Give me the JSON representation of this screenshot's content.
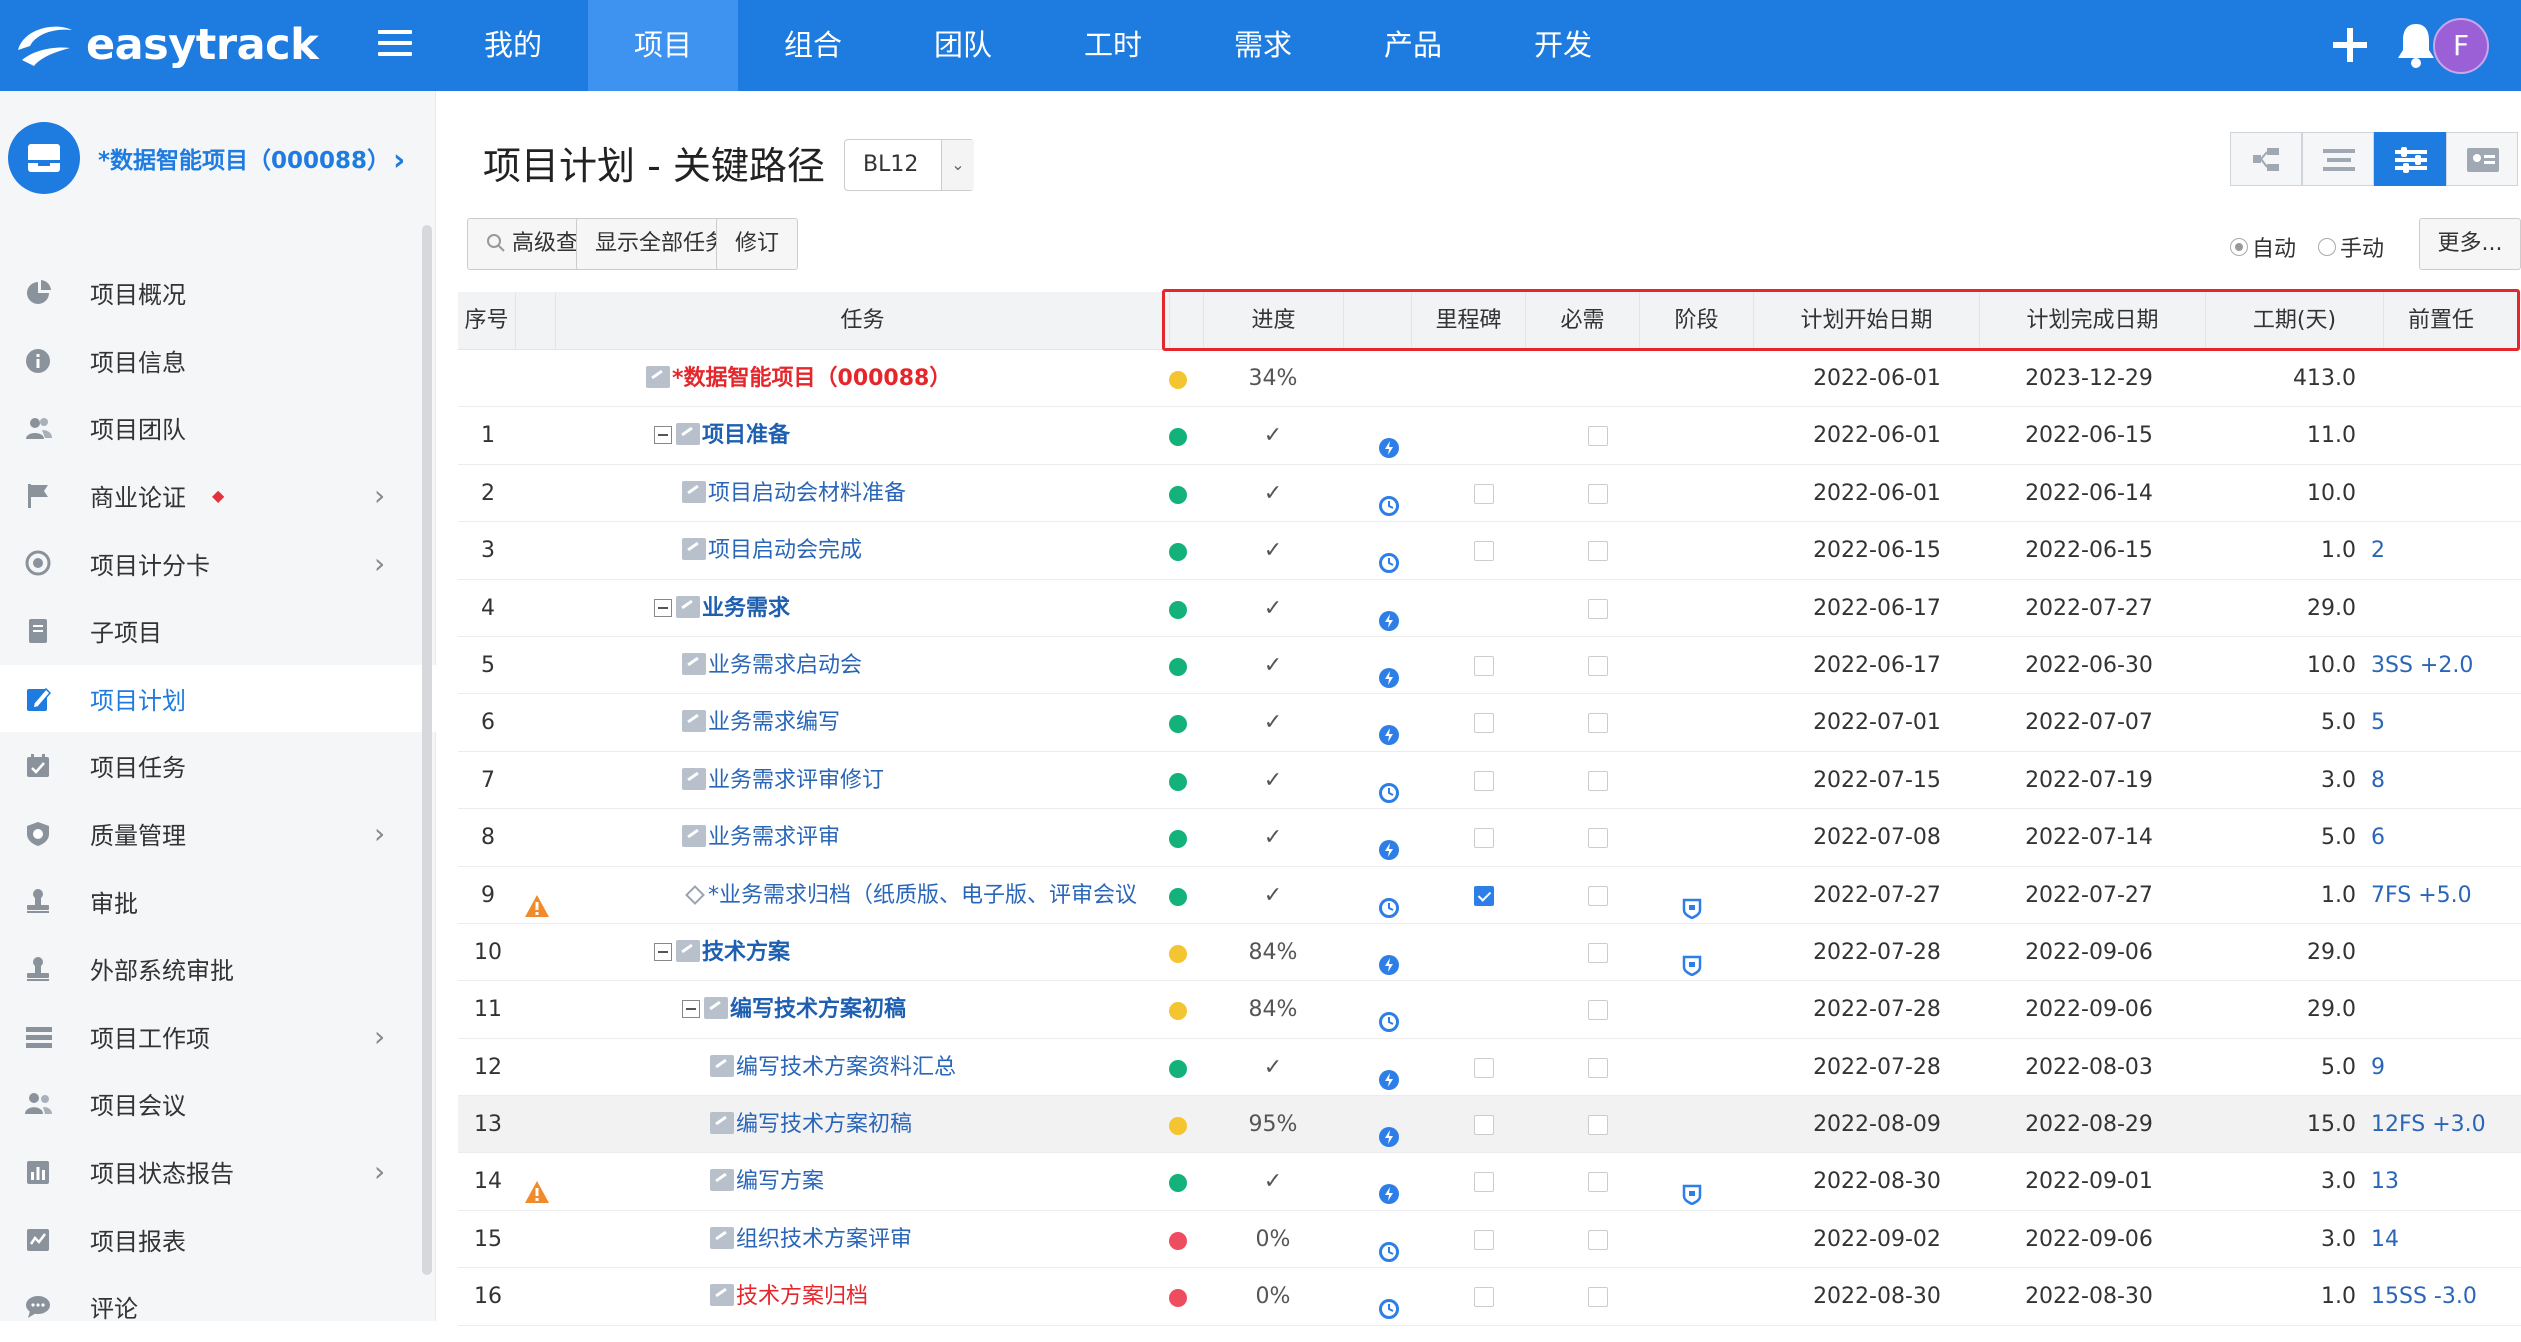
{
  "app": {
    "logo_text": "easytrack",
    "nav": [
      "我的",
      "项目",
      "组合",
      "团队",
      "工时",
      "需求",
      "产品",
      "开发"
    ],
    "active_nav": 1,
    "avatar_letter": "F",
    "accent_color": "#1e7be0"
  },
  "sidebar": {
    "project_title": "*数据智能项目（000088）",
    "items": [
      {
        "label": "项目概况",
        "icon": "pie-chart-icon",
        "has_arrow": false
      },
      {
        "label": "项目信息",
        "icon": "info-icon",
        "has_arrow": false
      },
      {
        "label": "项目团队",
        "icon": "team-icon",
        "has_arrow": false
      },
      {
        "label": "商业论证",
        "icon": "flag-icon",
        "has_arrow": true,
        "badge": "◆"
      },
      {
        "label": "项目计分卡",
        "icon": "target-icon",
        "has_arrow": true
      },
      {
        "label": "子项目",
        "icon": "document-icon",
        "has_arrow": false
      },
      {
        "label": "项目计划",
        "icon": "plan-icon",
        "has_arrow": false,
        "active": true
      },
      {
        "label": "项目任务",
        "icon": "calendar-icon",
        "has_arrow": false
      },
      {
        "label": "质量管理",
        "icon": "shield-icon",
        "has_arrow": true
      },
      {
        "label": "审批",
        "icon": "stamp-icon",
        "has_arrow": false
      },
      {
        "label": "外部系统审批",
        "icon": "stamp-icon",
        "has_arrow": false
      },
      {
        "label": "项目工作项",
        "icon": "list-icon",
        "has_arrow": true
      },
      {
        "label": "项目会议",
        "icon": "meeting-icon",
        "has_arrow": false
      },
      {
        "label": "项目状态报告",
        "icon": "bar-report-icon",
        "has_arrow": true
      },
      {
        "label": "项目报表",
        "icon": "chart-report-icon",
        "has_arrow": false
      },
      {
        "label": "评论",
        "icon": "comment-icon",
        "has_arrow": false
      }
    ]
  },
  "page": {
    "title": "项目计划 - 关键路径",
    "baseline": "BL12",
    "buttons": {
      "search": "高级查询",
      "show_all": "显示全部任务",
      "revise": "修订"
    },
    "radio_auto": "自动",
    "radio_manual": "手动",
    "more": "更多..."
  },
  "table": {
    "headers": {
      "seq": "序号",
      "task": "任务",
      "progress": "进度",
      "milestone": "里程碑",
      "required": "必需",
      "stage": "阶段",
      "start": "计划开始日期",
      "finish": "计划完成日期",
      "duration": "工期(天)",
      "predecessor": "前置任"
    },
    "rows": [
      {
        "num": "",
        "warn": false,
        "task": "*数据智能项目（000088）",
        "level": 0,
        "kind": "top",
        "status": "yellow",
        "progress": "34%",
        "ptype": "",
        "milestone": null,
        "required": null,
        "stage": false,
        "start": "2022-06-01",
        "finish": "2023-12-29",
        "duration": "413.0",
        "pred": ""
      },
      {
        "num": "1",
        "warn": false,
        "task": "项目准备",
        "level": 1,
        "kind": "summary",
        "status": "green",
        "progress": "✓",
        "ptype": "bolt",
        "milestone": null,
        "required": false,
        "stage": false,
        "start": "2022-06-01",
        "finish": "2022-06-15",
        "duration": "11.0",
        "pred": ""
      },
      {
        "num": "2",
        "warn": false,
        "task": "项目启动会材料准备",
        "level": 2,
        "kind": "task",
        "status": "green",
        "progress": "✓",
        "ptype": "clock",
        "milestone": false,
        "required": false,
        "stage": false,
        "start": "2022-06-01",
        "finish": "2022-06-14",
        "duration": "10.0",
        "pred": ""
      },
      {
        "num": "3",
        "warn": false,
        "task": "项目启动会完成",
        "level": 2,
        "kind": "task",
        "status": "green",
        "progress": "✓",
        "ptype": "clock",
        "milestone": false,
        "required": false,
        "stage": false,
        "start": "2022-06-15",
        "finish": "2022-06-15",
        "duration": "1.0",
        "pred": "2"
      },
      {
        "num": "4",
        "warn": false,
        "task": "业务需求",
        "level": 1,
        "kind": "summary",
        "status": "green",
        "progress": "✓",
        "ptype": "bolt",
        "milestone": null,
        "required": false,
        "stage": false,
        "start": "2022-06-17",
        "finish": "2022-07-27",
        "duration": "29.0",
        "pred": ""
      },
      {
        "num": "5",
        "warn": false,
        "task": "业务需求启动会",
        "level": 2,
        "kind": "task",
        "status": "green",
        "progress": "✓",
        "ptype": "bolt",
        "milestone": false,
        "required": false,
        "stage": false,
        "start": "2022-06-17",
        "finish": "2022-06-30",
        "duration": "10.0",
        "pred": "3SS +2.0"
      },
      {
        "num": "6",
        "warn": false,
        "task": "业务需求编写",
        "level": 2,
        "kind": "task",
        "status": "green",
        "progress": "✓",
        "ptype": "bolt",
        "milestone": false,
        "required": false,
        "stage": false,
        "start": "2022-07-01",
        "finish": "2022-07-07",
        "duration": "5.0",
        "pred": "5"
      },
      {
        "num": "7",
        "warn": false,
        "task": "业务需求评审修订",
        "level": 2,
        "kind": "task",
        "status": "green",
        "progress": "✓",
        "ptype": "clock",
        "milestone": false,
        "required": false,
        "stage": false,
        "start": "2022-07-15",
        "finish": "2022-07-19",
        "duration": "3.0",
        "pred": "8"
      },
      {
        "num": "8",
        "warn": false,
        "task": "业务需求评审",
        "level": 2,
        "kind": "task",
        "status": "green",
        "progress": "✓",
        "ptype": "bolt",
        "milestone": false,
        "required": false,
        "stage": false,
        "start": "2022-07-08",
        "finish": "2022-07-14",
        "duration": "5.0",
        "pred": "6"
      },
      {
        "num": "9",
        "warn": true,
        "task": "*业务需求归档（纸质版、电子版、评审会议",
        "level": 2,
        "kind": "milestone",
        "status": "green",
        "progress": "✓",
        "ptype": "clock",
        "milestone": true,
        "required": false,
        "stage": true,
        "start": "2022-07-27",
        "finish": "2022-07-27",
        "duration": "1.0",
        "pred": "7FS +5.0"
      },
      {
        "num": "10",
        "warn": false,
        "task": "技术方案",
        "level": 1,
        "kind": "summary",
        "status": "yellow",
        "progress": "84%",
        "ptype": "bolt",
        "milestone": null,
        "required": false,
        "stage": true,
        "start": "2022-07-28",
        "finish": "2022-09-06",
        "duration": "29.0",
        "pred": ""
      },
      {
        "num": "11",
        "warn": false,
        "task": "编写技术方案初稿",
        "level": 2,
        "kind": "summary",
        "status": "yellow",
        "progress": "84%",
        "ptype": "clock",
        "milestone": null,
        "required": false,
        "stage": false,
        "start": "2022-07-28",
        "finish": "2022-09-06",
        "duration": "29.0",
        "pred": ""
      },
      {
        "num": "12",
        "warn": false,
        "task": "编写技术方案资料汇总",
        "level": 3,
        "kind": "task",
        "status": "green",
        "progress": "✓",
        "ptype": "bolt",
        "milestone": false,
        "required": false,
        "stage": false,
        "start": "2022-07-28",
        "finish": "2022-08-03",
        "duration": "5.0",
        "pred": "9"
      },
      {
        "num": "13",
        "warn": false,
        "task": "编写技术方案初稿",
        "level": 3,
        "kind": "task",
        "status": "yellow",
        "progress": "95%",
        "ptype": "bolt",
        "milestone": false,
        "required": false,
        "stage": false,
        "start": "2022-08-09",
        "finish": "2022-08-29",
        "duration": "15.0",
        "pred": "12FS +3.0",
        "shaded": true
      },
      {
        "num": "14",
        "warn": true,
        "task": "编写方案",
        "level": 3,
        "kind": "task",
        "status": "green",
        "progress": "✓",
        "ptype": "bolt",
        "milestone": false,
        "required": false,
        "stage": true,
        "start": "2022-08-30",
        "finish": "2022-09-01",
        "duration": "3.0",
        "pred": "13"
      },
      {
        "num": "15",
        "warn": false,
        "task": "组织技术方案评审",
        "level": 3,
        "kind": "task",
        "status": "red",
        "progress": "0%",
        "ptype": "clock",
        "milestone": false,
        "required": false,
        "stage": false,
        "start": "2022-09-02",
        "finish": "2022-09-06",
        "duration": "3.0",
        "pred": "14"
      },
      {
        "num": "16",
        "warn": false,
        "task": "技术方案归档",
        "level": 3,
        "kind": "red",
        "status": "red",
        "progress": "0%",
        "ptype": "clock",
        "milestone": false,
        "required": false,
        "stage": false,
        "start": "2022-08-30",
        "finish": "2022-08-30",
        "duration": "1.0",
        "pred": "15SS -3.0"
      }
    ]
  },
  "colors": {
    "green": "#13b27a",
    "yellow": "#f5c531",
    "red": "#ee4d5f",
    "link": "#2a66b8",
    "warn": "#f08a2a"
  }
}
